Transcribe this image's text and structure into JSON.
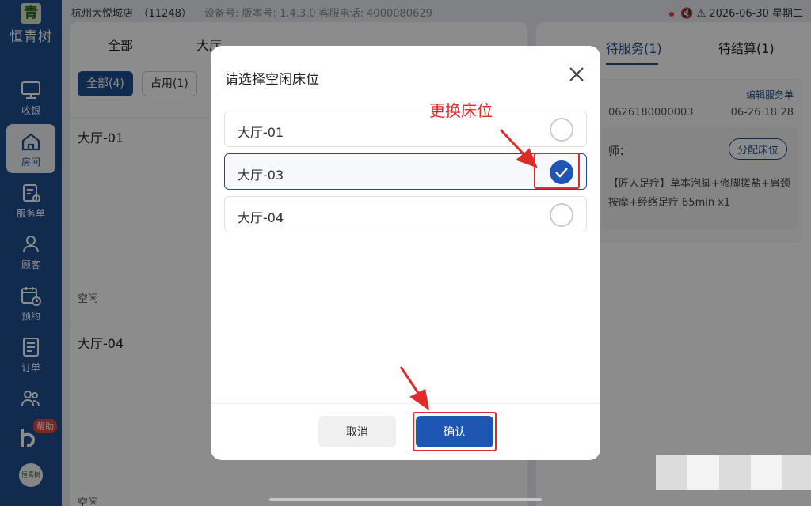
{
  "sidebar": {
    "brand_logo": "青",
    "brand_name": "恒青树",
    "items": [
      {
        "label": "收银",
        "icon": "monitor-icon"
      },
      {
        "label": "房间",
        "icon": "home-icon"
      },
      {
        "label": "服务单",
        "icon": "service-list-icon"
      },
      {
        "label": "顾客",
        "icon": "customer-icon"
      },
      {
        "label": "预约",
        "icon": "calendar-clock-icon"
      },
      {
        "label": "订单",
        "icon": "order-icon"
      },
      {
        "label": "",
        "icon": "staff-icon"
      }
    ],
    "help_badge": "帮助",
    "mini_logo": "恒青树"
  },
  "statusbar": {
    "store": "杭州大悦城店　（11248）",
    "device": "设备号:  版本号:  1.4.3.0  客服电话:  4000080629",
    "datetime": "2026-06-30 星期二"
  },
  "panel": {
    "tab_all": "全部",
    "tab_hall": "大厅",
    "chips": [
      "全部(4)",
      "占用(1)"
    ],
    "rooms": [
      {
        "title": "大厅-01",
        "status": "空闲"
      },
      {
        "title": "大厅-04",
        "status": "空闲"
      }
    ]
  },
  "rpanel": {
    "tab_waiting": "待服务(1)",
    "tab_settle": "待结算(1)",
    "edit_link": "编辑服务单",
    "order_no": "0626180000003",
    "order_time": "06-26 18:28",
    "tech_label": "师：",
    "assign_btn": "分配床位",
    "service_desc": "【匠人足疗】草本泡脚+修脚搓盐+肩颈按摩+经络足疗 65min x1"
  },
  "modal": {
    "title": "请选择空闲床位",
    "beds": [
      {
        "name": "大厅-01",
        "checked": false
      },
      {
        "name": "大厅-03",
        "checked": true
      },
      {
        "name": "大厅-04",
        "checked": false
      }
    ],
    "cancel": "取消",
    "confirm": "确认"
  },
  "annotation": {
    "text": "更换床位",
    "color": "#e02b2b"
  },
  "colors": {
    "primary": "#1f4f8f",
    "confirm": "#1f56b3"
  }
}
